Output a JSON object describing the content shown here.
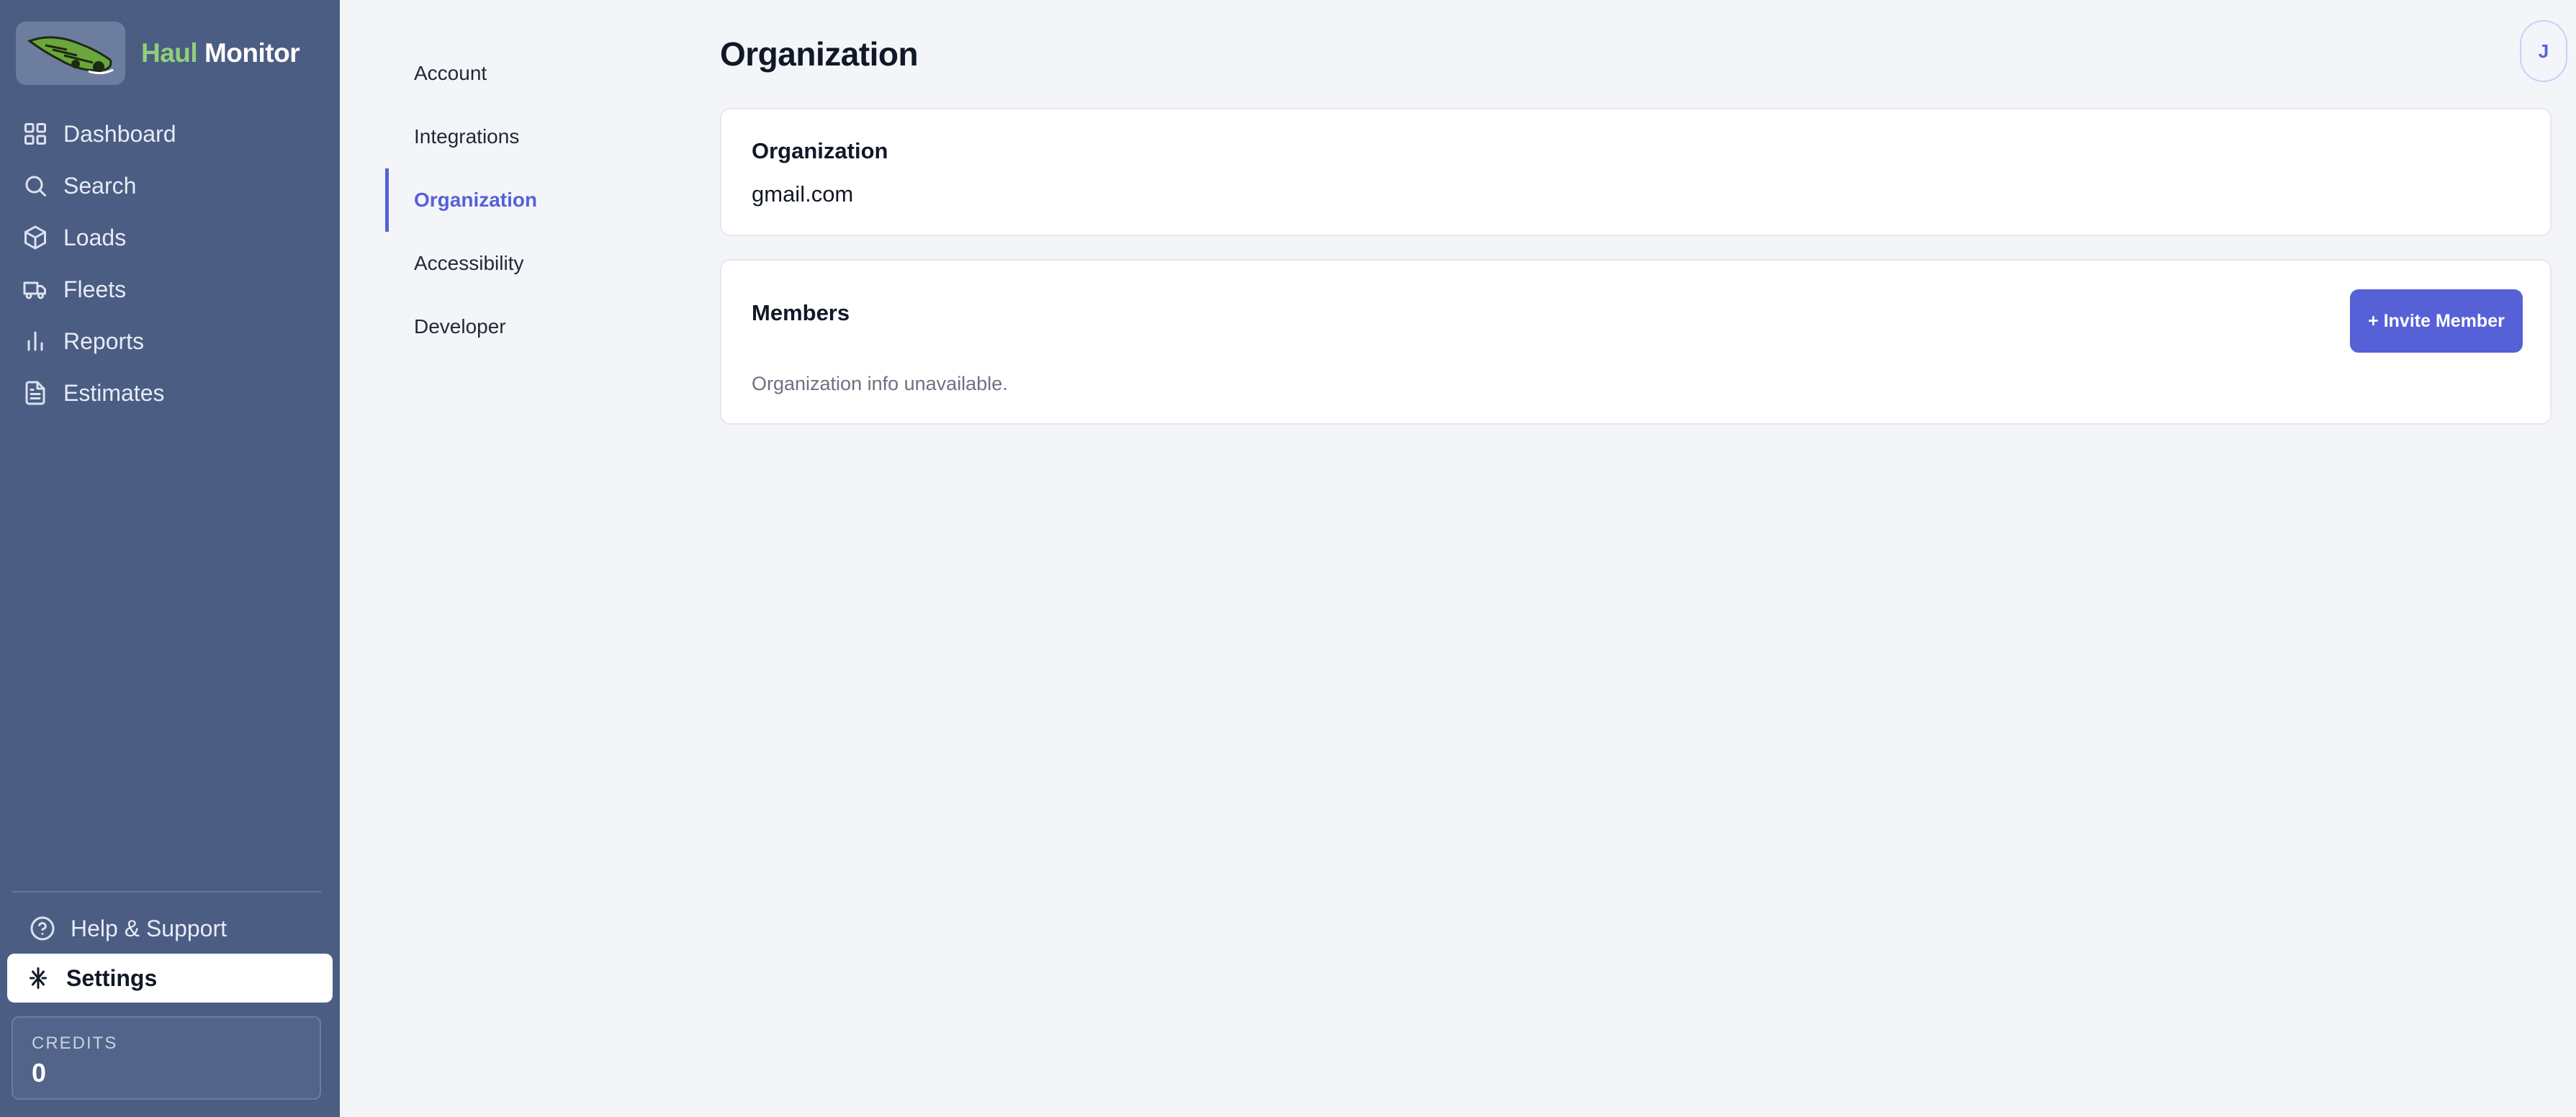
{
  "brand": {
    "name_part1": "Haul",
    "name_part2": "Monitor"
  },
  "sidebar": {
    "items": [
      {
        "label": "Dashboard",
        "icon": "grid-icon"
      },
      {
        "label": "Search",
        "icon": "search-icon"
      },
      {
        "label": "Loads",
        "icon": "box-icon"
      },
      {
        "label": "Fleets",
        "icon": "truck-icon"
      },
      {
        "label": "Reports",
        "icon": "bar-chart-icon"
      },
      {
        "label": "Estimates",
        "icon": "document-icon"
      }
    ],
    "bottom": {
      "help_label": "Help & Support",
      "settings_label": "Settings"
    },
    "credits": {
      "label": "CREDITS",
      "value": "0"
    }
  },
  "settings_nav": {
    "items": [
      {
        "label": "Account"
      },
      {
        "label": "Integrations"
      },
      {
        "label": "Organization"
      },
      {
        "label": "Accessibility"
      },
      {
        "label": "Developer"
      }
    ],
    "active": "Organization"
  },
  "page": {
    "title": "Organization"
  },
  "user": {
    "initial": "J"
  },
  "organization_card": {
    "title": "Organization",
    "domain": "gmail.com"
  },
  "members_card": {
    "title": "Members",
    "invite_label": "+ Invite Member",
    "empty_message": "Organization info unavailable."
  },
  "colors": {
    "sidebar_bg": "#4b5d83",
    "accent": "#5661d8",
    "brand_green": "#8fd07c",
    "page_bg": "#f3f5f9"
  }
}
